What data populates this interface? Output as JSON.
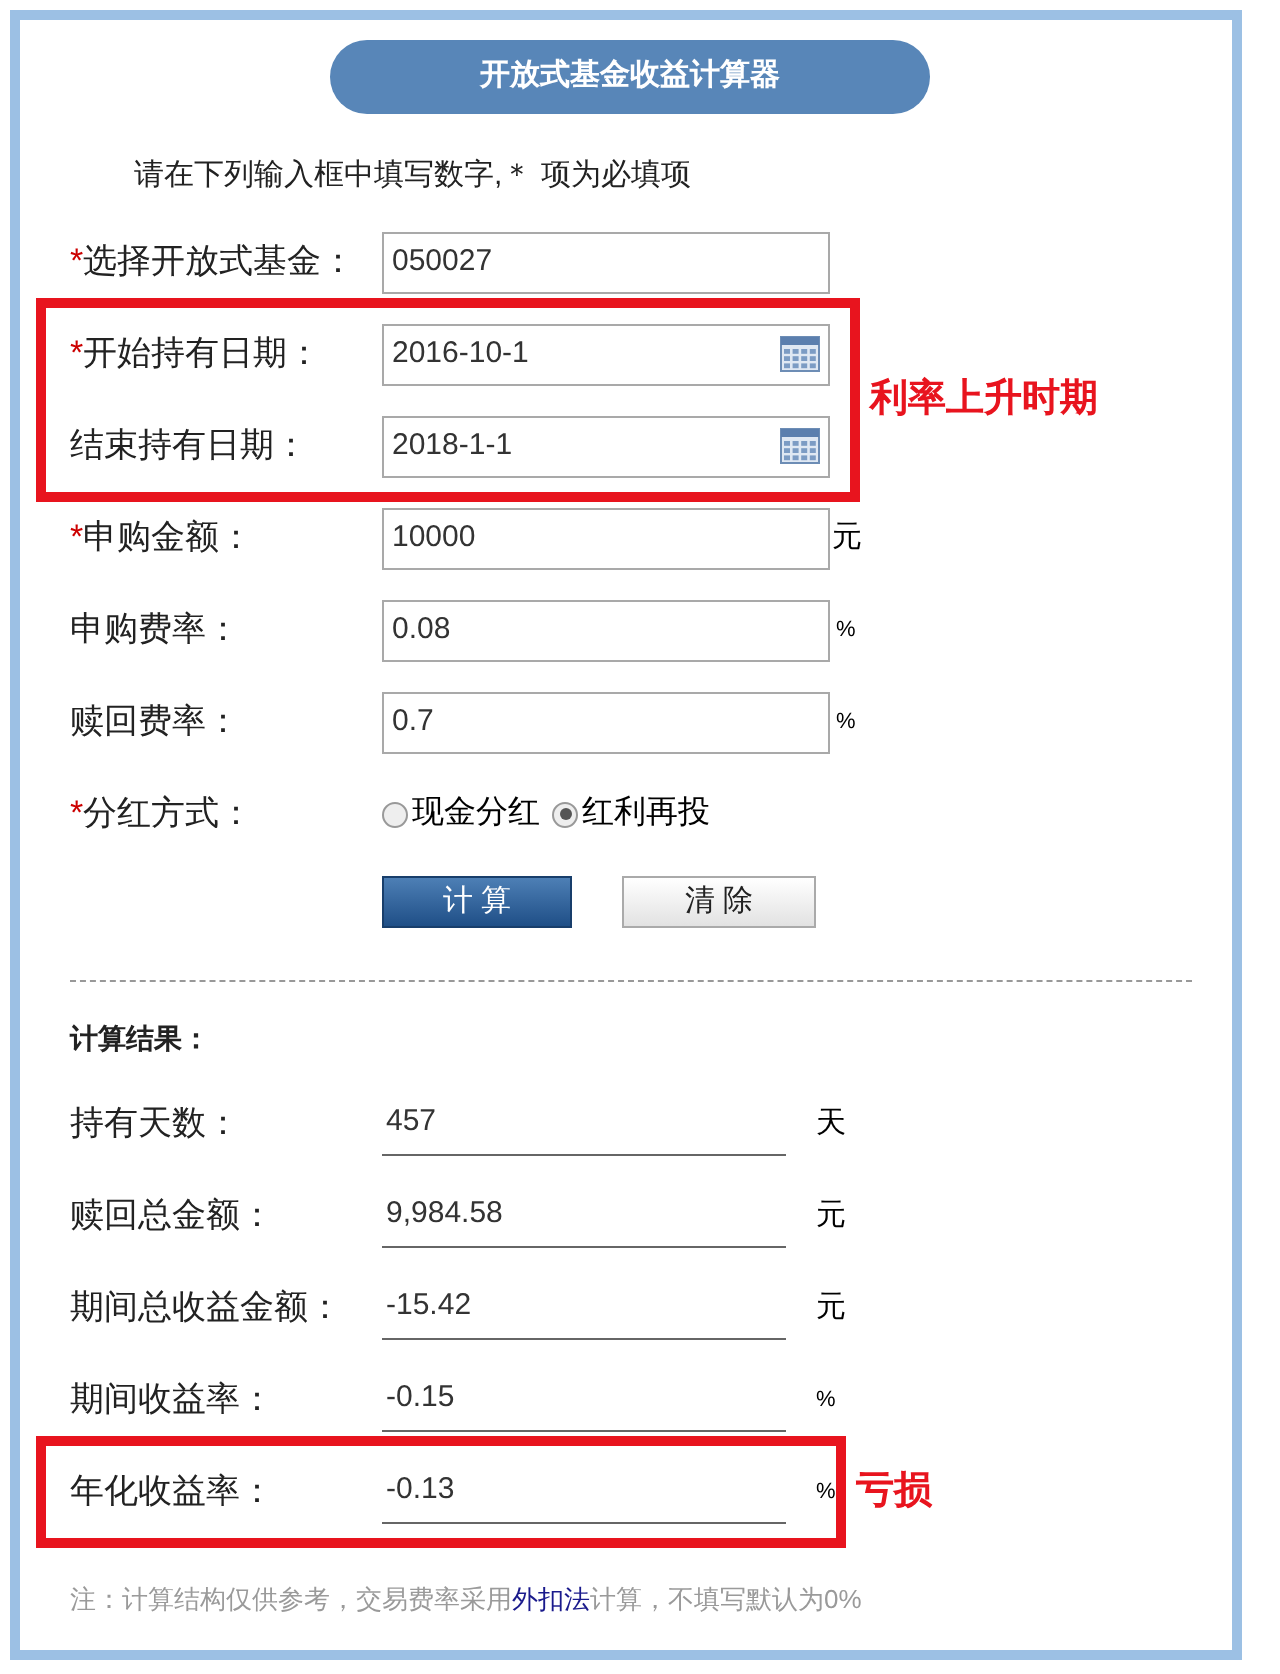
{
  "title": "开放式基金收益计算器",
  "instruction": "请在下列输入框中填写数字,＊ 项为必填项",
  "form": {
    "sections": [
      {
        "rows": [
          {
            "kind": "text",
            "label": "选择开放式基金：",
            "required_mark": "*",
            "value": "050027"
          }
        ]
      },
      {
        "highlight": {
          "text": "利率上升时期"
        },
        "rows": [
          {
            "kind": "date",
            "label": "开始持有日期：",
            "required_mark": "*",
            "value": "2016-10-1"
          },
          {
            "kind": "date",
            "label": "结束持有日期：",
            "value": "2018-1-1"
          }
        ]
      },
      {
        "rows": [
          {
            "kind": "text",
            "label": "申购金额：",
            "required_mark": "*",
            "value": "10000",
            "unit": "元"
          },
          {
            "kind": "text",
            "label": "申购费率：",
            "value": "0.08",
            "unit": "%"
          },
          {
            "kind": "text",
            "label": "赎回费率：",
            "value": "0.7",
            "unit": "%"
          },
          {
            "kind": "radio",
            "label": "分红方式：",
            "required_mark": "*",
            "options": [
              {
                "label": "现金分红",
                "selected": false
              },
              {
                "label": "红利再投",
                "selected": true
              }
            ]
          }
        ]
      }
    ]
  },
  "buttons": [
    {
      "label": "计 算",
      "kind": "primary"
    },
    {
      "label": "清 除",
      "kind": "secondary"
    }
  ],
  "results": {
    "heading": "计算结果：",
    "sections": [
      {
        "rows": [
          {
            "label": "持有天数：",
            "value": "457",
            "unit": "天"
          },
          {
            "label": "赎回总金额：",
            "value": "9,984.58",
            "unit": "元"
          },
          {
            "label": "期间总收益金额：",
            "value": "-15.42",
            "unit": "元"
          },
          {
            "label": "期间收益率：",
            "value": "-0.15",
            "unit": "%"
          }
        ]
      },
      {
        "highlight": {
          "text": "亏损"
        },
        "rows": [
          {
            "label": "年化收益率：",
            "value": "-0.13",
            "unit": "%"
          }
        ]
      }
    ]
  },
  "note": {
    "before": "注：计算结构仅供参考，交易费率采用",
    "link": "外扣法",
    "after": "计算，不填写默认为0%"
  }
}
